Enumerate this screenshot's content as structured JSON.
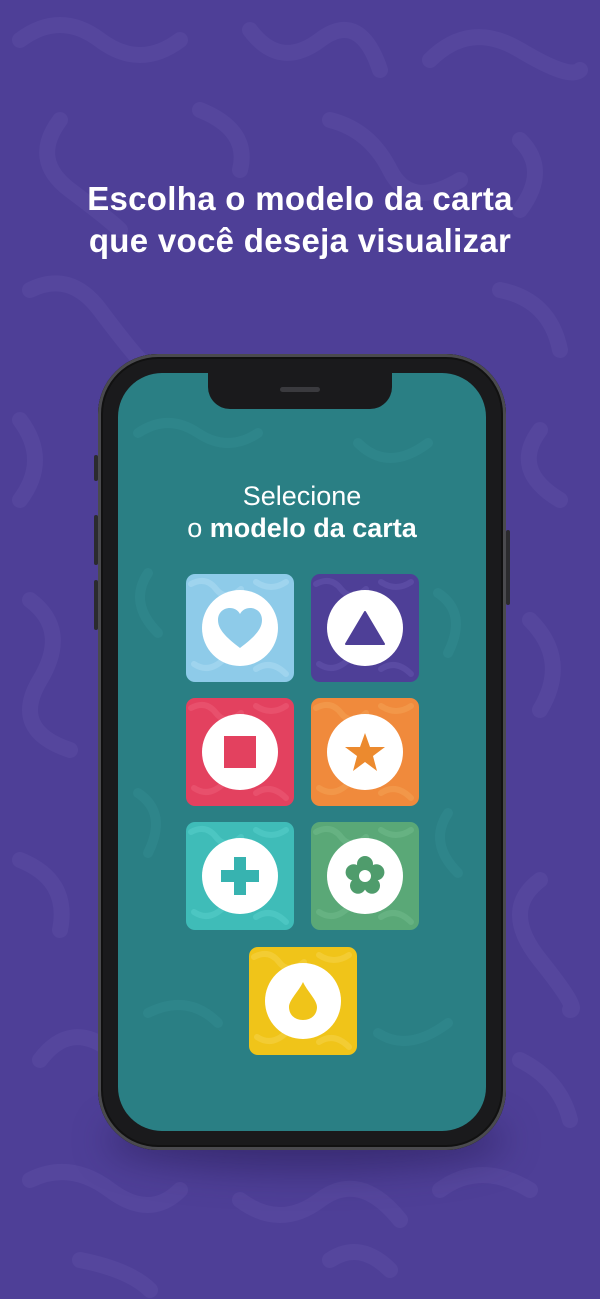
{
  "headline": {
    "line1": "Escolha o modelo da carta",
    "line2": "que você deseja visualizar"
  },
  "screen": {
    "title_line1": "Selecione",
    "title_line2_prefix": "o ",
    "title_line2_bold": "modelo da carta"
  },
  "colors": {
    "background": "#4e3f97",
    "screen": "#2a7f84",
    "heart_card": "#8ecbe9",
    "heart_icon": "#8ecbe9",
    "triangle_card": "#4e3f97",
    "triangle_icon": "#4e3f97",
    "square_card": "#e3415f",
    "square_icon": "#e3415f",
    "star_card": "#f08a3c",
    "star_icon": "#ec8a2e",
    "plus_card": "#3fbcb8",
    "plus_icon": "#37b3b0",
    "flower_card": "#5aa877",
    "flower_icon": "#4f9c6c",
    "drop_card": "#f0c419",
    "drop_icon": "#f0c419"
  },
  "cards": [
    {
      "name": "heart-card",
      "icon": "heart-icon"
    },
    {
      "name": "triangle-card",
      "icon": "triangle-icon"
    },
    {
      "name": "square-card",
      "icon": "square-icon"
    },
    {
      "name": "star-card",
      "icon": "star-icon"
    },
    {
      "name": "plus-card",
      "icon": "plus-icon"
    },
    {
      "name": "flower-card",
      "icon": "flower-icon"
    },
    {
      "name": "drop-card",
      "icon": "drop-icon"
    }
  ]
}
